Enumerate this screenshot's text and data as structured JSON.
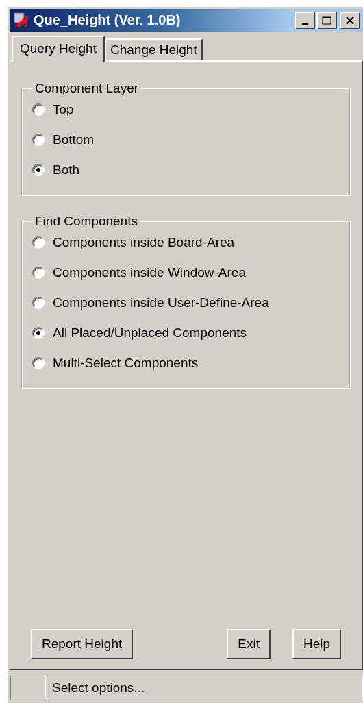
{
  "window": {
    "title": "Que_Height (Ver. 1.0B)"
  },
  "tabs": [
    {
      "label": "Query Height",
      "selected": true
    },
    {
      "label": "Change Height",
      "selected": false
    }
  ],
  "groups": [
    {
      "title": "Component Layer",
      "options": [
        {
          "label": "Top",
          "selected": false
        },
        {
          "label": "Bottom",
          "selected": false
        },
        {
          "label": "Both",
          "selected": true
        }
      ]
    },
    {
      "title": "Find Components",
      "options": [
        {
          "label": "Components inside Board-Area",
          "selected": false
        },
        {
          "label": "Components inside Window-Area",
          "selected": false
        },
        {
          "label": "Components inside User-Define-Area",
          "selected": false
        },
        {
          "label": "All Placed/Unplaced Components",
          "selected": true
        },
        {
          "label": "Multi-Select Components",
          "selected": false
        }
      ]
    }
  ],
  "buttons": [
    "Report Height",
    "Exit",
    "Help"
  ],
  "status_bar": {
    "text": "Select options..."
  }
}
